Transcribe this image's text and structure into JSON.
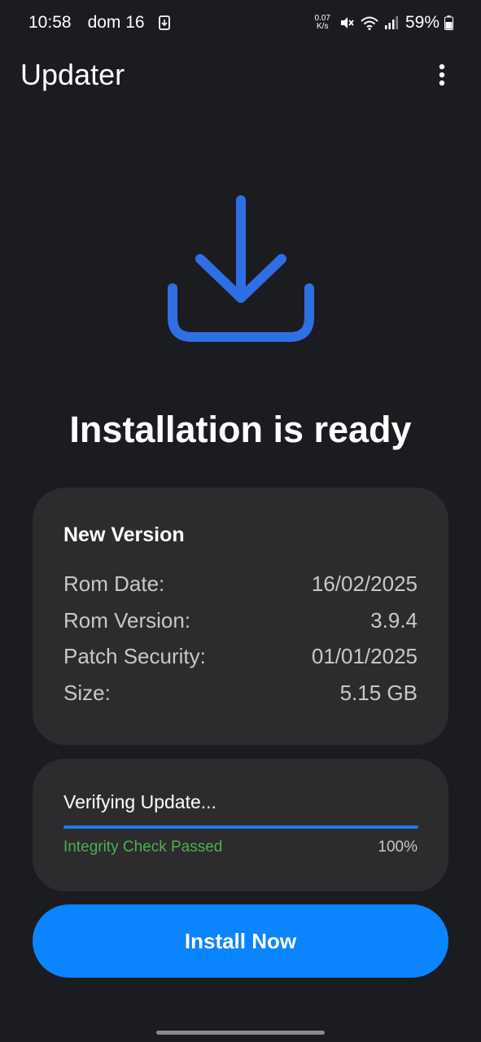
{
  "status_bar": {
    "time": "10:58",
    "date": "dom 16",
    "net_speed_value": "0.07",
    "net_speed_unit": "K/s",
    "battery": "59%",
    "icons": [
      "download-notification-icon",
      "mute-icon",
      "wifi-icon",
      "signal-icon",
      "battery-icon"
    ]
  },
  "app_bar": {
    "title": "Updater",
    "menu_icon": "more-vert-icon"
  },
  "hero": {
    "icon": "download-icon",
    "headline": "Installation is ready",
    "accent_color": "#2f6fe4"
  },
  "version_card": {
    "title": "New Version",
    "rows": [
      {
        "label": "Rom Date:",
        "value": "16/02/2025"
      },
      {
        "label": "Rom Version:",
        "value": "3.9.4"
      },
      {
        "label": "Patch Security:",
        "value": "01/01/2025"
      },
      {
        "label": "Size:",
        "value": "5.15 GB"
      }
    ]
  },
  "progress_card": {
    "title": "Verifying Update...",
    "status": "Integrity Check Passed",
    "percent_label": "100%",
    "progress": 1.0,
    "status_color": "#4caf50",
    "bar_color": "#1e7be6"
  },
  "install_button": {
    "label": "Install Now",
    "color": "#0a84ff"
  }
}
